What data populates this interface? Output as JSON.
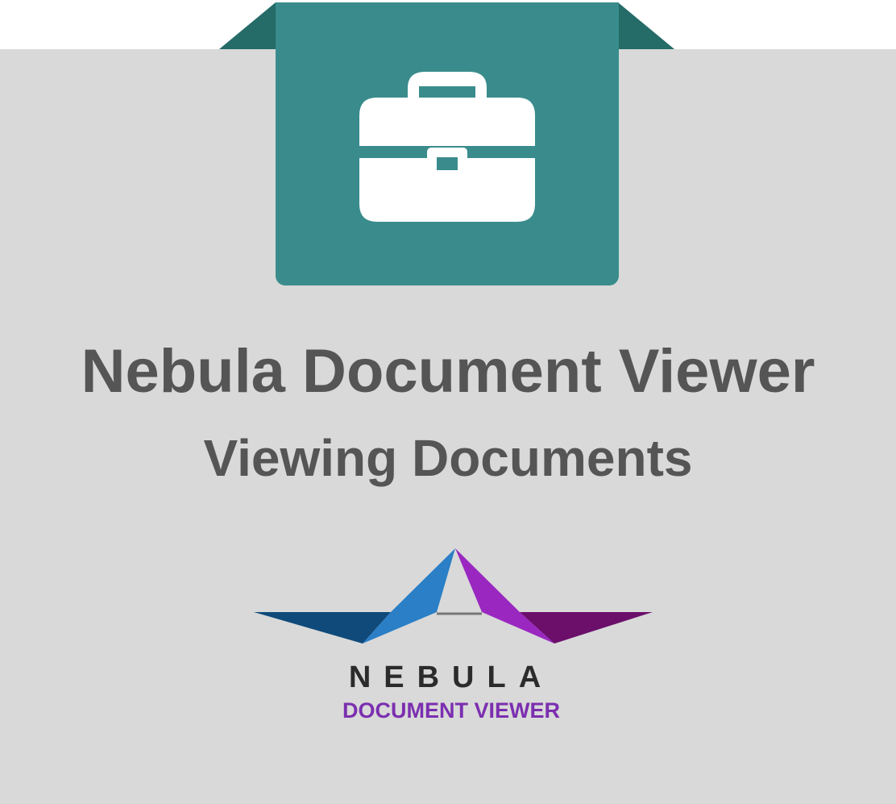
{
  "app": {
    "title": "Nebula Document Viewer",
    "subtitle": "Viewing Documents"
  },
  "ribbon": {
    "icon": "briefcase-icon",
    "color": "#3a8c8c",
    "wing_color": "#256b68"
  },
  "logo": {
    "wordmark": "NEBULA",
    "tagline": "DOCUMENT VIEWER",
    "colors": {
      "navy": "#0f4a7a",
      "blue": "#2a7fc6",
      "purple": "#9a28c0",
      "plum": "#6b0f6b",
      "tagline": "#7b2fb0",
      "wordmark": "#2b2b2b"
    }
  },
  "colors": {
    "background": "#d9d9d9",
    "text": "#555555"
  }
}
